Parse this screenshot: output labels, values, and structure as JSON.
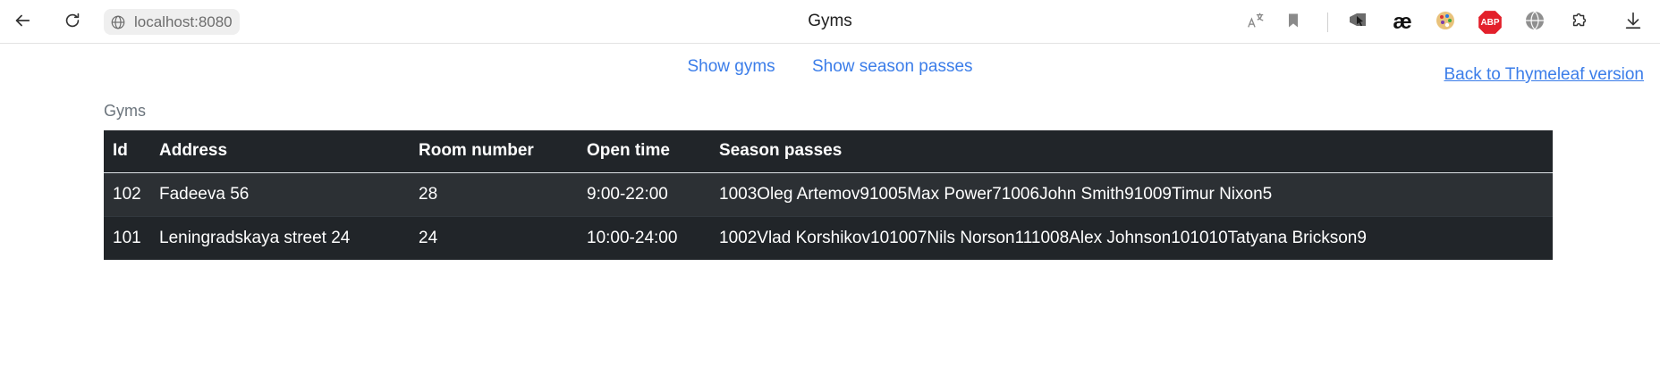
{
  "browser": {
    "url": "localhost:8080",
    "tab_title": "Gyms"
  },
  "nav": {
    "show_gyms": "Show gyms",
    "show_season_passes": "Show season passes",
    "back_link": "Back to Thymeleaf version"
  },
  "section": {
    "label": "Gyms"
  },
  "table": {
    "headers": [
      "Id",
      "Address",
      "Room number",
      "Open time",
      "Season passes"
    ],
    "rows": [
      [
        "102",
        "Fadeeva 56",
        "28",
        "9:00-22:00",
        "1003Oleg Artemov91005Max Power71006John Smith91009Timur Nixon5"
      ],
      [
        "101",
        "Leningradskaya street 24",
        "24",
        "10:00-24:00",
        "1002Vlad Korshikov101007Nils Norson111008Alex Johnson101010Tatyana Brickson9"
      ]
    ]
  },
  "colors": {
    "link": "#3b7de9",
    "table_bg": "#212529",
    "table_stripe": "#2c3034",
    "muted_text": "#6c757d"
  },
  "icons": {
    "back": "arrow-left-icon",
    "reload": "reload-icon",
    "site_info": "globe-icon",
    "translate": "translate-icon",
    "bookmark": "bookmark-icon",
    "extensions": [
      "cursor-extension-icon",
      "ae-extension-icon",
      "palette-extension-icon",
      "adblock-plus-icon",
      "web-extension-icon",
      "puzzle-icon",
      "download-icon"
    ],
    "abp_label": "ABP",
    "ae_label": "æ"
  }
}
